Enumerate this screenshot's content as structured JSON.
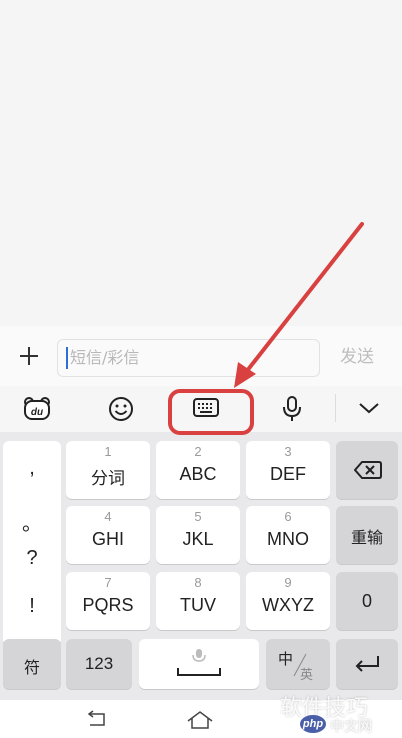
{
  "compose": {
    "placeholder": "短信/彩信",
    "send_label": "发送"
  },
  "toolbar": {
    "items": [
      "baidu-bear-icon",
      "emoji-icon",
      "keyboard-icon",
      "microphone-icon",
      "collapse-chevron-icon"
    ]
  },
  "keyboard": {
    "punctuation": [
      ",",
      "。",
      "?",
      "!"
    ],
    "rows": [
      [
        {
          "num": "1",
          "label": "分词"
        },
        {
          "num": "2",
          "label": "ABC"
        },
        {
          "num": "3",
          "label": "DEF"
        }
      ],
      [
        {
          "num": "4",
          "label": "GHI"
        },
        {
          "num": "5",
          "label": "JKL"
        },
        {
          "num": "6",
          "label": "MNO"
        }
      ],
      [
        {
          "num": "7",
          "label": "PQRS"
        },
        {
          "num": "8",
          "label": "TUV"
        },
        {
          "num": "9",
          "label": "WXYZ"
        }
      ]
    ],
    "right": {
      "retype_label": "重输",
      "zero_label": "0"
    },
    "bottom": {
      "symbol_label": "符",
      "num_label": "123",
      "lang_cn": "中",
      "lang_en": "英"
    }
  },
  "watermark": {
    "text": "软件技巧",
    "site": "中文网",
    "logo": "php"
  },
  "colors": {
    "annotation_red": "#d94040",
    "caret_blue": "#2b6fd6"
  }
}
